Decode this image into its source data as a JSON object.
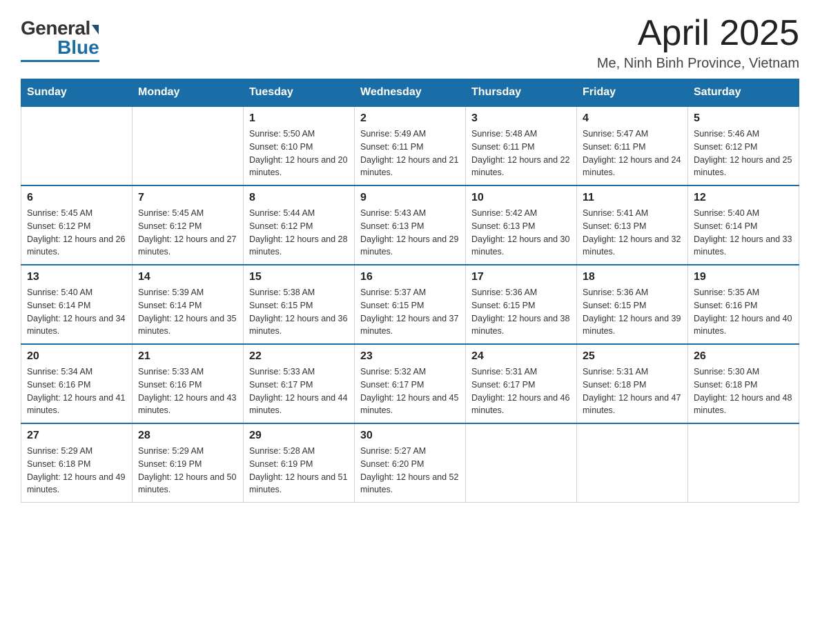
{
  "logo": {
    "general": "General",
    "blue": "Blue"
  },
  "header": {
    "month": "April 2025",
    "location": "Me, Ninh Binh Province, Vietnam"
  },
  "weekdays": [
    "Sunday",
    "Monday",
    "Tuesday",
    "Wednesday",
    "Thursday",
    "Friday",
    "Saturday"
  ],
  "weeks": [
    [
      {
        "day": "",
        "sunrise": "",
        "sunset": "",
        "daylight": ""
      },
      {
        "day": "",
        "sunrise": "",
        "sunset": "",
        "daylight": ""
      },
      {
        "day": "1",
        "sunrise": "Sunrise: 5:50 AM",
        "sunset": "Sunset: 6:10 PM",
        "daylight": "Daylight: 12 hours and 20 minutes."
      },
      {
        "day": "2",
        "sunrise": "Sunrise: 5:49 AM",
        "sunset": "Sunset: 6:11 PM",
        "daylight": "Daylight: 12 hours and 21 minutes."
      },
      {
        "day": "3",
        "sunrise": "Sunrise: 5:48 AM",
        "sunset": "Sunset: 6:11 PM",
        "daylight": "Daylight: 12 hours and 22 minutes."
      },
      {
        "day": "4",
        "sunrise": "Sunrise: 5:47 AM",
        "sunset": "Sunset: 6:11 PM",
        "daylight": "Daylight: 12 hours and 24 minutes."
      },
      {
        "day": "5",
        "sunrise": "Sunrise: 5:46 AM",
        "sunset": "Sunset: 6:12 PM",
        "daylight": "Daylight: 12 hours and 25 minutes."
      }
    ],
    [
      {
        "day": "6",
        "sunrise": "Sunrise: 5:45 AM",
        "sunset": "Sunset: 6:12 PM",
        "daylight": "Daylight: 12 hours and 26 minutes."
      },
      {
        "day": "7",
        "sunrise": "Sunrise: 5:45 AM",
        "sunset": "Sunset: 6:12 PM",
        "daylight": "Daylight: 12 hours and 27 minutes."
      },
      {
        "day": "8",
        "sunrise": "Sunrise: 5:44 AM",
        "sunset": "Sunset: 6:12 PM",
        "daylight": "Daylight: 12 hours and 28 minutes."
      },
      {
        "day": "9",
        "sunrise": "Sunrise: 5:43 AM",
        "sunset": "Sunset: 6:13 PM",
        "daylight": "Daylight: 12 hours and 29 minutes."
      },
      {
        "day": "10",
        "sunrise": "Sunrise: 5:42 AM",
        "sunset": "Sunset: 6:13 PM",
        "daylight": "Daylight: 12 hours and 30 minutes."
      },
      {
        "day": "11",
        "sunrise": "Sunrise: 5:41 AM",
        "sunset": "Sunset: 6:13 PM",
        "daylight": "Daylight: 12 hours and 32 minutes."
      },
      {
        "day": "12",
        "sunrise": "Sunrise: 5:40 AM",
        "sunset": "Sunset: 6:14 PM",
        "daylight": "Daylight: 12 hours and 33 minutes."
      }
    ],
    [
      {
        "day": "13",
        "sunrise": "Sunrise: 5:40 AM",
        "sunset": "Sunset: 6:14 PM",
        "daylight": "Daylight: 12 hours and 34 minutes."
      },
      {
        "day": "14",
        "sunrise": "Sunrise: 5:39 AM",
        "sunset": "Sunset: 6:14 PM",
        "daylight": "Daylight: 12 hours and 35 minutes."
      },
      {
        "day": "15",
        "sunrise": "Sunrise: 5:38 AM",
        "sunset": "Sunset: 6:15 PM",
        "daylight": "Daylight: 12 hours and 36 minutes."
      },
      {
        "day": "16",
        "sunrise": "Sunrise: 5:37 AM",
        "sunset": "Sunset: 6:15 PM",
        "daylight": "Daylight: 12 hours and 37 minutes."
      },
      {
        "day": "17",
        "sunrise": "Sunrise: 5:36 AM",
        "sunset": "Sunset: 6:15 PM",
        "daylight": "Daylight: 12 hours and 38 minutes."
      },
      {
        "day": "18",
        "sunrise": "Sunrise: 5:36 AM",
        "sunset": "Sunset: 6:15 PM",
        "daylight": "Daylight: 12 hours and 39 minutes."
      },
      {
        "day": "19",
        "sunrise": "Sunrise: 5:35 AM",
        "sunset": "Sunset: 6:16 PM",
        "daylight": "Daylight: 12 hours and 40 minutes."
      }
    ],
    [
      {
        "day": "20",
        "sunrise": "Sunrise: 5:34 AM",
        "sunset": "Sunset: 6:16 PM",
        "daylight": "Daylight: 12 hours and 41 minutes."
      },
      {
        "day": "21",
        "sunrise": "Sunrise: 5:33 AM",
        "sunset": "Sunset: 6:16 PM",
        "daylight": "Daylight: 12 hours and 43 minutes."
      },
      {
        "day": "22",
        "sunrise": "Sunrise: 5:33 AM",
        "sunset": "Sunset: 6:17 PM",
        "daylight": "Daylight: 12 hours and 44 minutes."
      },
      {
        "day": "23",
        "sunrise": "Sunrise: 5:32 AM",
        "sunset": "Sunset: 6:17 PM",
        "daylight": "Daylight: 12 hours and 45 minutes."
      },
      {
        "day": "24",
        "sunrise": "Sunrise: 5:31 AM",
        "sunset": "Sunset: 6:17 PM",
        "daylight": "Daylight: 12 hours and 46 minutes."
      },
      {
        "day": "25",
        "sunrise": "Sunrise: 5:31 AM",
        "sunset": "Sunset: 6:18 PM",
        "daylight": "Daylight: 12 hours and 47 minutes."
      },
      {
        "day": "26",
        "sunrise": "Sunrise: 5:30 AM",
        "sunset": "Sunset: 6:18 PM",
        "daylight": "Daylight: 12 hours and 48 minutes."
      }
    ],
    [
      {
        "day": "27",
        "sunrise": "Sunrise: 5:29 AM",
        "sunset": "Sunset: 6:18 PM",
        "daylight": "Daylight: 12 hours and 49 minutes."
      },
      {
        "day": "28",
        "sunrise": "Sunrise: 5:29 AM",
        "sunset": "Sunset: 6:19 PM",
        "daylight": "Daylight: 12 hours and 50 minutes."
      },
      {
        "day": "29",
        "sunrise": "Sunrise: 5:28 AM",
        "sunset": "Sunset: 6:19 PM",
        "daylight": "Daylight: 12 hours and 51 minutes."
      },
      {
        "day": "30",
        "sunrise": "Sunrise: 5:27 AM",
        "sunset": "Sunset: 6:20 PM",
        "daylight": "Daylight: 12 hours and 52 minutes."
      },
      {
        "day": "",
        "sunrise": "",
        "sunset": "",
        "daylight": ""
      },
      {
        "day": "",
        "sunrise": "",
        "sunset": "",
        "daylight": ""
      },
      {
        "day": "",
        "sunrise": "",
        "sunset": "",
        "daylight": ""
      }
    ]
  ]
}
